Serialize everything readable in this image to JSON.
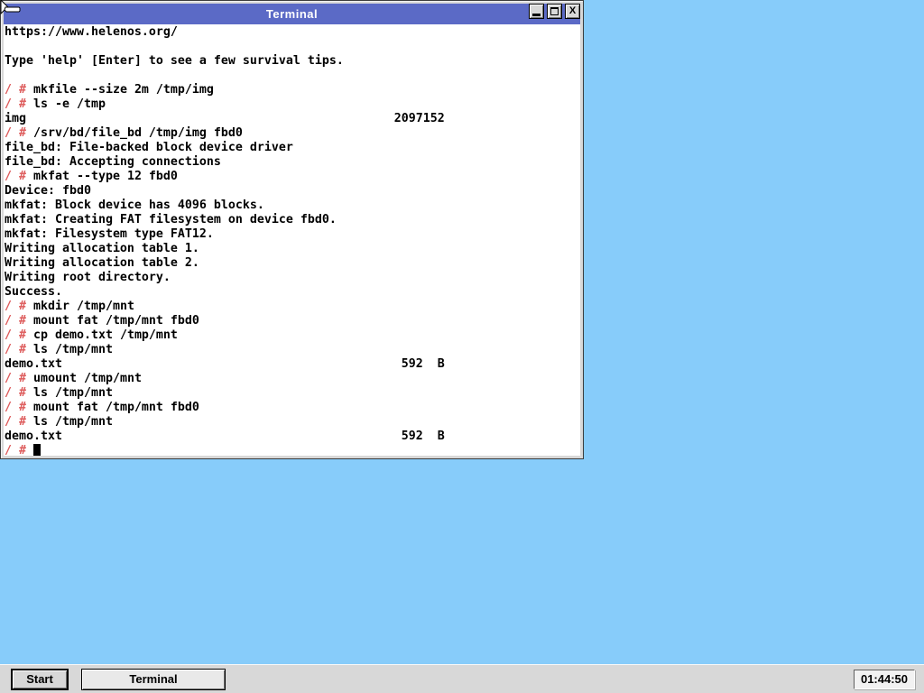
{
  "colors": {
    "desktop_bg": "#87CCFA",
    "titlebar": "#5B6AC6",
    "chrome": "#D8D8D8",
    "prompt": "#DD5A5A",
    "task_face": "#E9E9E9"
  },
  "window": {
    "title": "Terminal",
    "controls": {
      "minimize_icon": "minimize-icon",
      "maximize_icon": "maximize-icon",
      "close_icon": "close-icon",
      "close_glyph": "X"
    }
  },
  "terminal": {
    "prompt": "/ #",
    "lines": [
      [
        [
          "t",
          "https://www.helenos.org/"
        ]
      ],
      [],
      [
        [
          "t",
          "Type 'help' [Enter] to see a few survival tips."
        ]
      ],
      [],
      [
        [
          "p",
          "/ #"
        ],
        [
          "t",
          " mkfile --size 2m /tmp/img"
        ]
      ],
      [
        [
          "p",
          "/ #"
        ],
        [
          "t",
          " ls -e /tmp"
        ]
      ],
      [
        [
          "t",
          "img"
        ],
        [
          "pad",
          54
        ],
        [
          "t",
          "2097152"
        ]
      ],
      [
        [
          "p",
          "/ #"
        ],
        [
          "t",
          " /srv/bd/file_bd /tmp/img fbd0"
        ]
      ],
      [
        [
          "t",
          "file_bd: File-backed block device driver"
        ]
      ],
      [
        [
          "t",
          "file_bd: Accepting connections"
        ]
      ],
      [
        [
          "p",
          "/ #"
        ],
        [
          "t",
          " mkfat --type 12 fbd0"
        ]
      ],
      [
        [
          "t",
          "Device: fbd0"
        ]
      ],
      [
        [
          "t",
          "mkfat: Block device has 4096 blocks."
        ]
      ],
      [
        [
          "t",
          "mkfat: Creating FAT filesystem on device fbd0."
        ]
      ],
      [
        [
          "t",
          "mkfat: Filesystem type FAT12."
        ]
      ],
      [
        [
          "t",
          "Writing allocation table 1."
        ]
      ],
      [
        [
          "t",
          "Writing allocation table 2."
        ]
      ],
      [
        [
          "t",
          "Writing root directory."
        ]
      ],
      [
        [
          "t",
          "Success."
        ]
      ],
      [
        [
          "p",
          "/ #"
        ],
        [
          "t",
          " mkdir /tmp/mnt"
        ]
      ],
      [
        [
          "p",
          "/ #"
        ],
        [
          "t",
          " mount fat /tmp/mnt fbd0"
        ]
      ],
      [
        [
          "p",
          "/ #"
        ],
        [
          "t",
          " cp demo.txt /tmp/mnt"
        ]
      ],
      [
        [
          "p",
          "/ #"
        ],
        [
          "t",
          " ls /tmp/mnt"
        ]
      ],
      [
        [
          "t",
          "demo.txt"
        ],
        [
          "pad",
          55
        ],
        [
          "t",
          "592"
        ],
        [
          "pad",
          60
        ],
        [
          "t",
          "B"
        ]
      ],
      [
        [
          "p",
          "/ #"
        ],
        [
          "t",
          " umount /tmp/mnt"
        ]
      ],
      [
        [
          "p",
          "/ #"
        ],
        [
          "t",
          " ls /tmp/mnt"
        ]
      ],
      [
        [
          "p",
          "/ #"
        ],
        [
          "t",
          " mount fat /tmp/mnt fbd0"
        ]
      ],
      [
        [
          "p",
          "/ #"
        ],
        [
          "t",
          " ls /tmp/mnt"
        ]
      ],
      [
        [
          "t",
          "demo.txt"
        ],
        [
          "pad",
          55
        ],
        [
          "t",
          "592"
        ],
        [
          "pad",
          60
        ],
        [
          "t",
          "B"
        ]
      ],
      [
        [
          "p",
          "/ #"
        ],
        [
          "t",
          " "
        ],
        [
          "c",
          " "
        ]
      ]
    ]
  },
  "taskbar": {
    "start_label": "Start",
    "tasks": [
      {
        "label": "Terminal"
      }
    ],
    "clock": "01:44:50"
  }
}
